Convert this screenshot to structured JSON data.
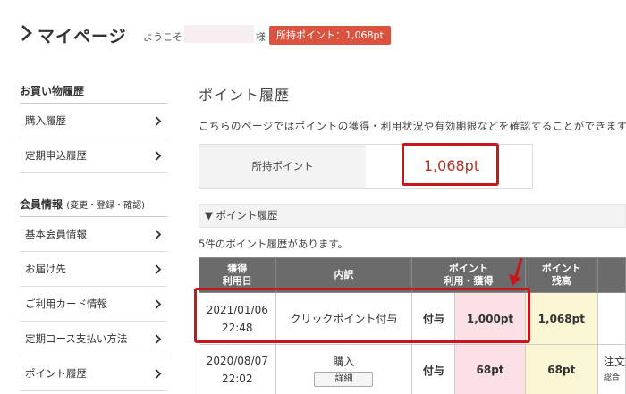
{
  "header": {
    "title": "マイページ",
    "welcome_prefix": "ようこそ",
    "welcome_suffix": "様",
    "points_badge": "所持ポイント：1,068pt"
  },
  "sidebar": {
    "shopping_heading": "お買い物履歴",
    "shopping_items": [
      {
        "label": "購入履歴"
      },
      {
        "label": "定期申込履歴"
      }
    ],
    "member_heading": "会員情報",
    "member_heading_note": "(変更・登録・確認)",
    "member_items": [
      {
        "label": "基本会員情報"
      },
      {
        "label": "お届け先"
      },
      {
        "label": "ご利用カード情報"
      },
      {
        "label": "定期コース支払い方法"
      },
      {
        "label": "ポイント履歴"
      }
    ]
  },
  "main": {
    "title": "ポイント履歴",
    "description": "こちらのページではポイントの獲得・利用状況や有効期限などを確認することができます。",
    "owned_label": "所持ポイント",
    "owned_value": "1,068pt",
    "accordion_label": "▼ ポイント履歴",
    "count_text": "5件のポイント履歴があります。"
  },
  "table": {
    "headers": {
      "date_line1": "獲得",
      "date_line2": "利用日",
      "detail": "内訳",
      "points_line1": "ポイント",
      "points_line2": "利用・獲得",
      "balance_line1": "ポイント",
      "balance_line2": "残高"
    },
    "rows": [
      {
        "date": "2021/01/06",
        "time": "22:48",
        "detail": "クリックポイント付与",
        "type": "付与",
        "points": "1,000pt",
        "balance": "1,068pt",
        "note1": "",
        "note2": ""
      },
      {
        "date": "2020/08/07",
        "time": "22:02",
        "detail": "購入",
        "detail_button": "詳細",
        "type": "付与",
        "points": "68pt",
        "balance": "68pt",
        "note1": "注文",
        "note2": "総合"
      }
    ]
  },
  "colors": {
    "accent_red": "#c8161d",
    "badge_bg": "#d9533f",
    "header_gray": "#6b6b6b",
    "points_pink": "#fbe0e6",
    "balance_yellow": "#fbf7d5"
  }
}
